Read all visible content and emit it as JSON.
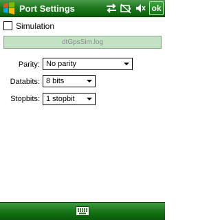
{
  "window": {
    "title": "Port Settings",
    "ok_label": "ok"
  },
  "icons": {
    "start": "windows-flag-icon",
    "connectivity": "connection-arrows-icon",
    "battery": "battery-icon",
    "volume": "volume-muted-icon",
    "keyboard": "keyboard-icon"
  },
  "simulation": {
    "label": "Simulation",
    "checked": false,
    "file": "dtGpsSim.log"
  },
  "form": {
    "parity": {
      "label": "Parity:",
      "value": "No parity"
    },
    "databits": {
      "label": "Databits:",
      "value": "8 bits"
    },
    "stopbits": {
      "label": "Stopbits:",
      "value": "1 stopbit"
    }
  },
  "colors": {
    "title_bar": "#1f7a1f",
    "file_field_bg": "#c3e2c3",
    "file_field_text": "#8c8c8c"
  }
}
